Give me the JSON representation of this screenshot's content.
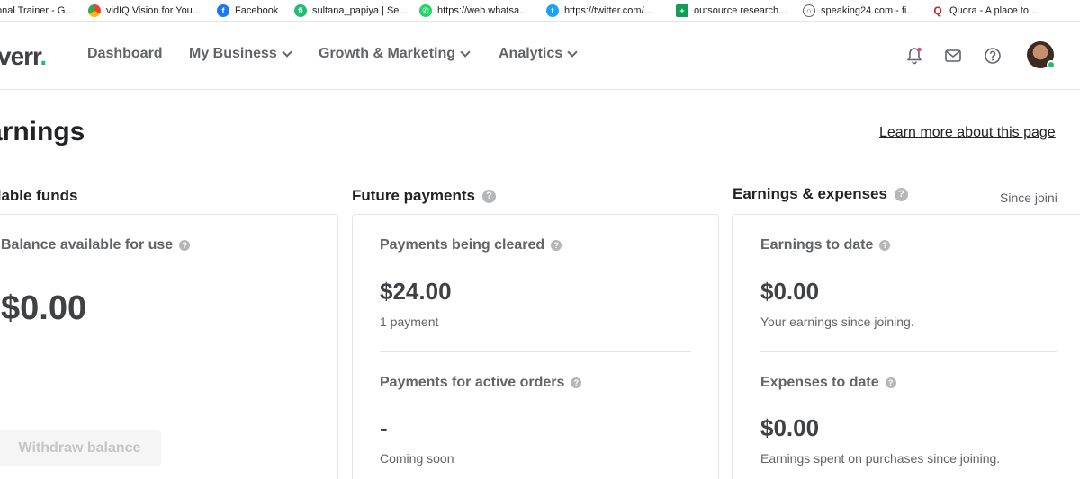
{
  "bookmarks": [
    {
      "label": "onal Trainer - G...",
      "icon": "google-drive-icon",
      "color": "#f4b400"
    },
    {
      "label": "vidIQ Vision for You...",
      "icon": "chrome-webstore-icon",
      "color": "#ea4335"
    },
    {
      "label": "Facebook",
      "icon": "facebook-icon",
      "color": "#1877f2"
    },
    {
      "label": "sultana_papiya | Se...",
      "icon": "fiverr-icon",
      "color": "#1dbf73"
    },
    {
      "label": "https://web.whatsa...",
      "icon": "whatsapp-icon",
      "color": "#25d366"
    },
    {
      "label": "https://twitter.com/...",
      "icon": "twitter-icon",
      "color": "#1da1f2"
    },
    {
      "label": "outsource research...",
      "icon": "sheets-icon",
      "color": "#0f9d58"
    },
    {
      "label": "speaking24.com - fi...",
      "icon": "headphones-icon",
      "color": "#5f6368"
    },
    {
      "label": "Quora - A place to...",
      "icon": "quora-icon",
      "color": "#b92b27"
    }
  ],
  "nav": {
    "logo_text": "verr",
    "logo_dot": ".",
    "items": [
      {
        "label": "Dashboard"
      },
      {
        "label": "My Business"
      },
      {
        "label": "Growth & Marketing"
      },
      {
        "label": "Analytics"
      }
    ],
    "icons": [
      "bell-icon",
      "mail-icon",
      "help-icon"
    ]
  },
  "page": {
    "title": "arnings",
    "learn_more": "Learn more about this page"
  },
  "available": {
    "title": "ilable funds",
    "label": "Balance available for use",
    "amount": "$0.00",
    "withdraw": "Withdraw balance"
  },
  "future": {
    "title": "Future payments",
    "cleared_label": "Payments being cleared",
    "cleared_amount": "$24.00",
    "cleared_sub": "1 payment",
    "active_label": "Payments for active orders",
    "active_amount": "-",
    "active_sub": "Coming soon"
  },
  "earnings": {
    "title": "Earnings & expenses",
    "since": "Since joini",
    "earnings_label": "Earnings to date",
    "earnings_amount": "$0.00",
    "earnings_sub": "Your earnings since joining.",
    "expenses_label": "Expenses to date",
    "expenses_amount": "$0.00",
    "expenses_sub": "Earnings spent on purchases since joining."
  },
  "colors": {
    "brand": "#1dbf73",
    "text": "#404145",
    "muted": "#62646a"
  }
}
